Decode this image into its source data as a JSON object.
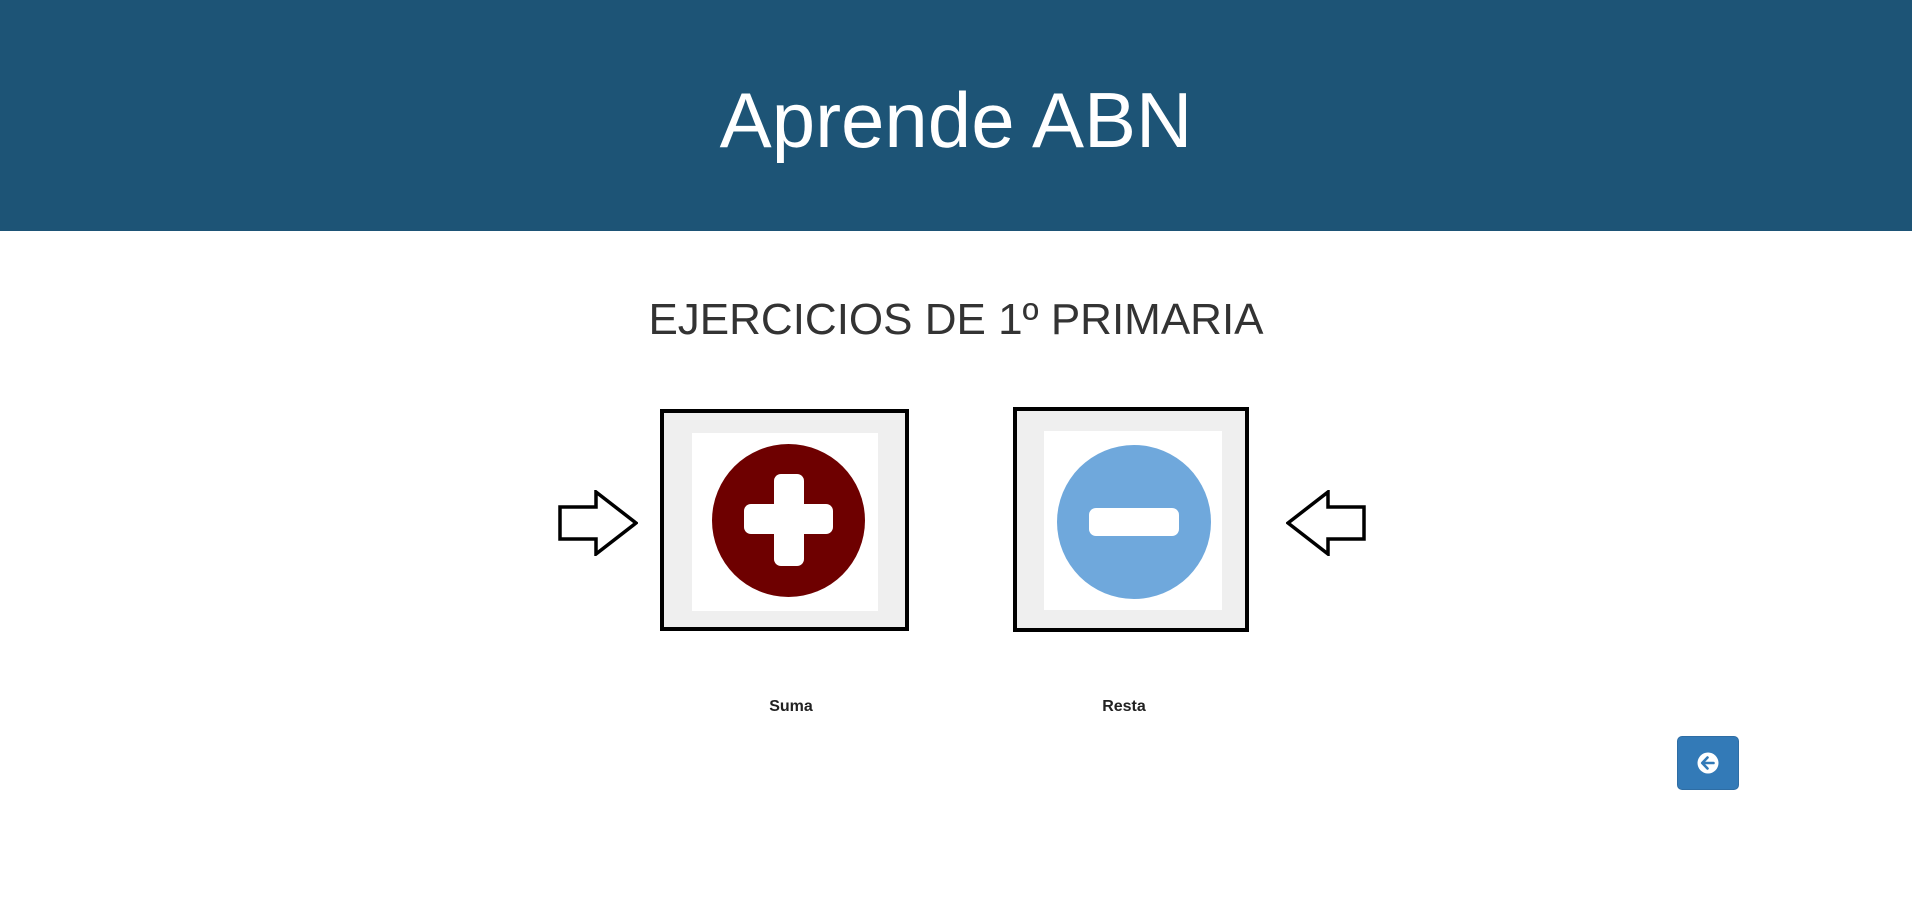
{
  "header": {
    "title": "Aprende ABN"
  },
  "main": {
    "section_title": "EJERCICIOS DE 1º PRIMARIA",
    "operations": [
      {
        "label": "Suma",
        "icon": "plus-circle-icon",
        "color": "#6e0000",
        "selected": true
      },
      {
        "label": "Resta",
        "icon": "minus-circle-icon",
        "color": "#6fa8dc",
        "selected": true
      }
    ]
  },
  "colors": {
    "header_bg": "#1d5476",
    "button_bg": "#337ab7"
  },
  "back_button": {
    "icon": "arrow-circle-left-icon"
  }
}
